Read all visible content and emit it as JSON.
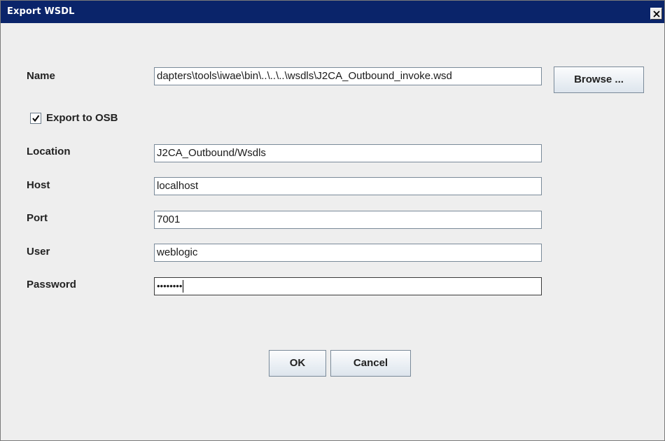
{
  "window": {
    "title": "Export WSDL"
  },
  "form": {
    "name_label": "Name",
    "name_value": "dapters\\tools\\iwae\\bin\\..\\..\\..\\wsdls\\J2CA_Outbound_invoke.wsd",
    "browse_label": "Browse ...",
    "export_osb_label": "Export to OSB",
    "export_osb_checked": true,
    "location_label": "Location",
    "location_value": "J2CA_Outbound/Wsdls",
    "host_label": "Host",
    "host_value": "localhost",
    "port_label": "Port",
    "port_value": "7001",
    "user_label": "User",
    "user_value": "weblogic",
    "password_label": "Password",
    "password_mask": "••••••••"
  },
  "buttons": {
    "ok_label": "OK",
    "cancel_label": "Cancel"
  },
  "icons": {
    "close": "close-icon",
    "check": "checkmark-icon"
  },
  "colors": {
    "titlebar": "#0a246a",
    "dialog_bg": "#eeeeee"
  }
}
